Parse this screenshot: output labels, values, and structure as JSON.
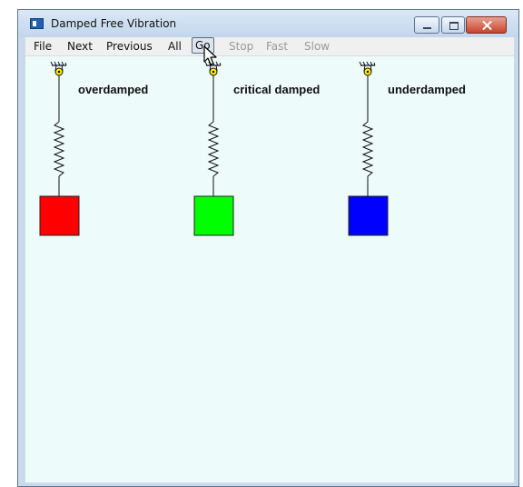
{
  "window": {
    "title": "Damped Free Vibration",
    "controls": [
      "minimize",
      "maximize",
      "close"
    ]
  },
  "menu": {
    "items": [
      {
        "label": "File",
        "enabled": true
      },
      {
        "label": "Next",
        "enabled": true
      },
      {
        "label": "Previous",
        "enabled": true
      },
      {
        "label": "All",
        "enabled": true
      },
      {
        "label": "Go",
        "enabled": true,
        "highlighted": true
      },
      {
        "label": "Stop",
        "enabled": false
      },
      {
        "label": "Fast",
        "enabled": false
      },
      {
        "label": "Slow",
        "enabled": false
      }
    ]
  },
  "systems": [
    {
      "label": "overdamped",
      "mass_color": "#ff0000"
    },
    {
      "label": "critical damped",
      "mass_color": "#00ff00"
    },
    {
      "label": "underdamped",
      "mass_color": "#0000ff"
    }
  ],
  "icons": {
    "app": "app-window-icon",
    "support": "pivot-support-icon",
    "cursor": "mouse-pointer-icon"
  }
}
